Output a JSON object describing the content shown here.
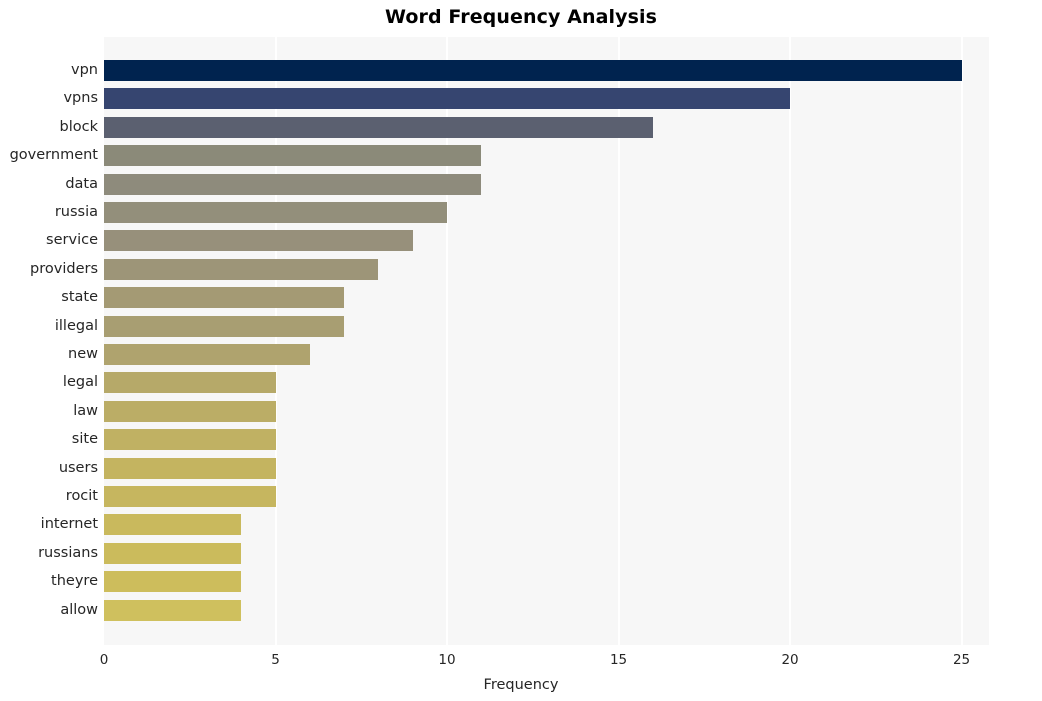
{
  "chart_data": {
    "type": "bar",
    "orientation": "horizontal",
    "title": "Word Frequency Analysis",
    "xlabel": "Frequency",
    "ylabel": "",
    "xlim": [
      0,
      25.8
    ],
    "xticks": [
      0,
      5,
      10,
      15,
      20,
      25
    ],
    "xtick_labels": [
      "0",
      "5",
      "10",
      "15",
      "20",
      "25"
    ],
    "grid": "vertical-white-on-light-gray",
    "legend": "none",
    "categories": [
      "vpn",
      "vpns",
      "block",
      "government",
      "data",
      "russia",
      "service",
      "providers",
      "state",
      "illegal",
      "new",
      "legal",
      "law",
      "site",
      "users",
      "rocit",
      "internet",
      "russians",
      "theyre",
      "allow"
    ],
    "values": [
      25,
      20,
      16,
      11,
      11,
      10,
      9,
      8,
      7,
      7,
      6,
      5,
      5,
      5,
      5,
      5,
      4,
      4,
      4,
      4
    ],
    "bar_colors": [
      "#00234f",
      "#364570",
      "#5b6070",
      "#8b8a79",
      "#8e8b7c",
      "#938f7b",
      "#97907b",
      "#9d9578",
      "#a49a74",
      "#a89e72",
      "#afa36e",
      "#b6a969",
      "#bbad66",
      "#c0b163",
      "#c4b460",
      "#c6b65f",
      "#c9b95d",
      "#cbbb5c",
      "#cdbd5c",
      "#cfc05e"
    ],
    "plot_background": "#f7f7f7",
    "gridline_color": "#ffffff",
    "title_color": "#000000",
    "tick_label_color": "#262626"
  }
}
